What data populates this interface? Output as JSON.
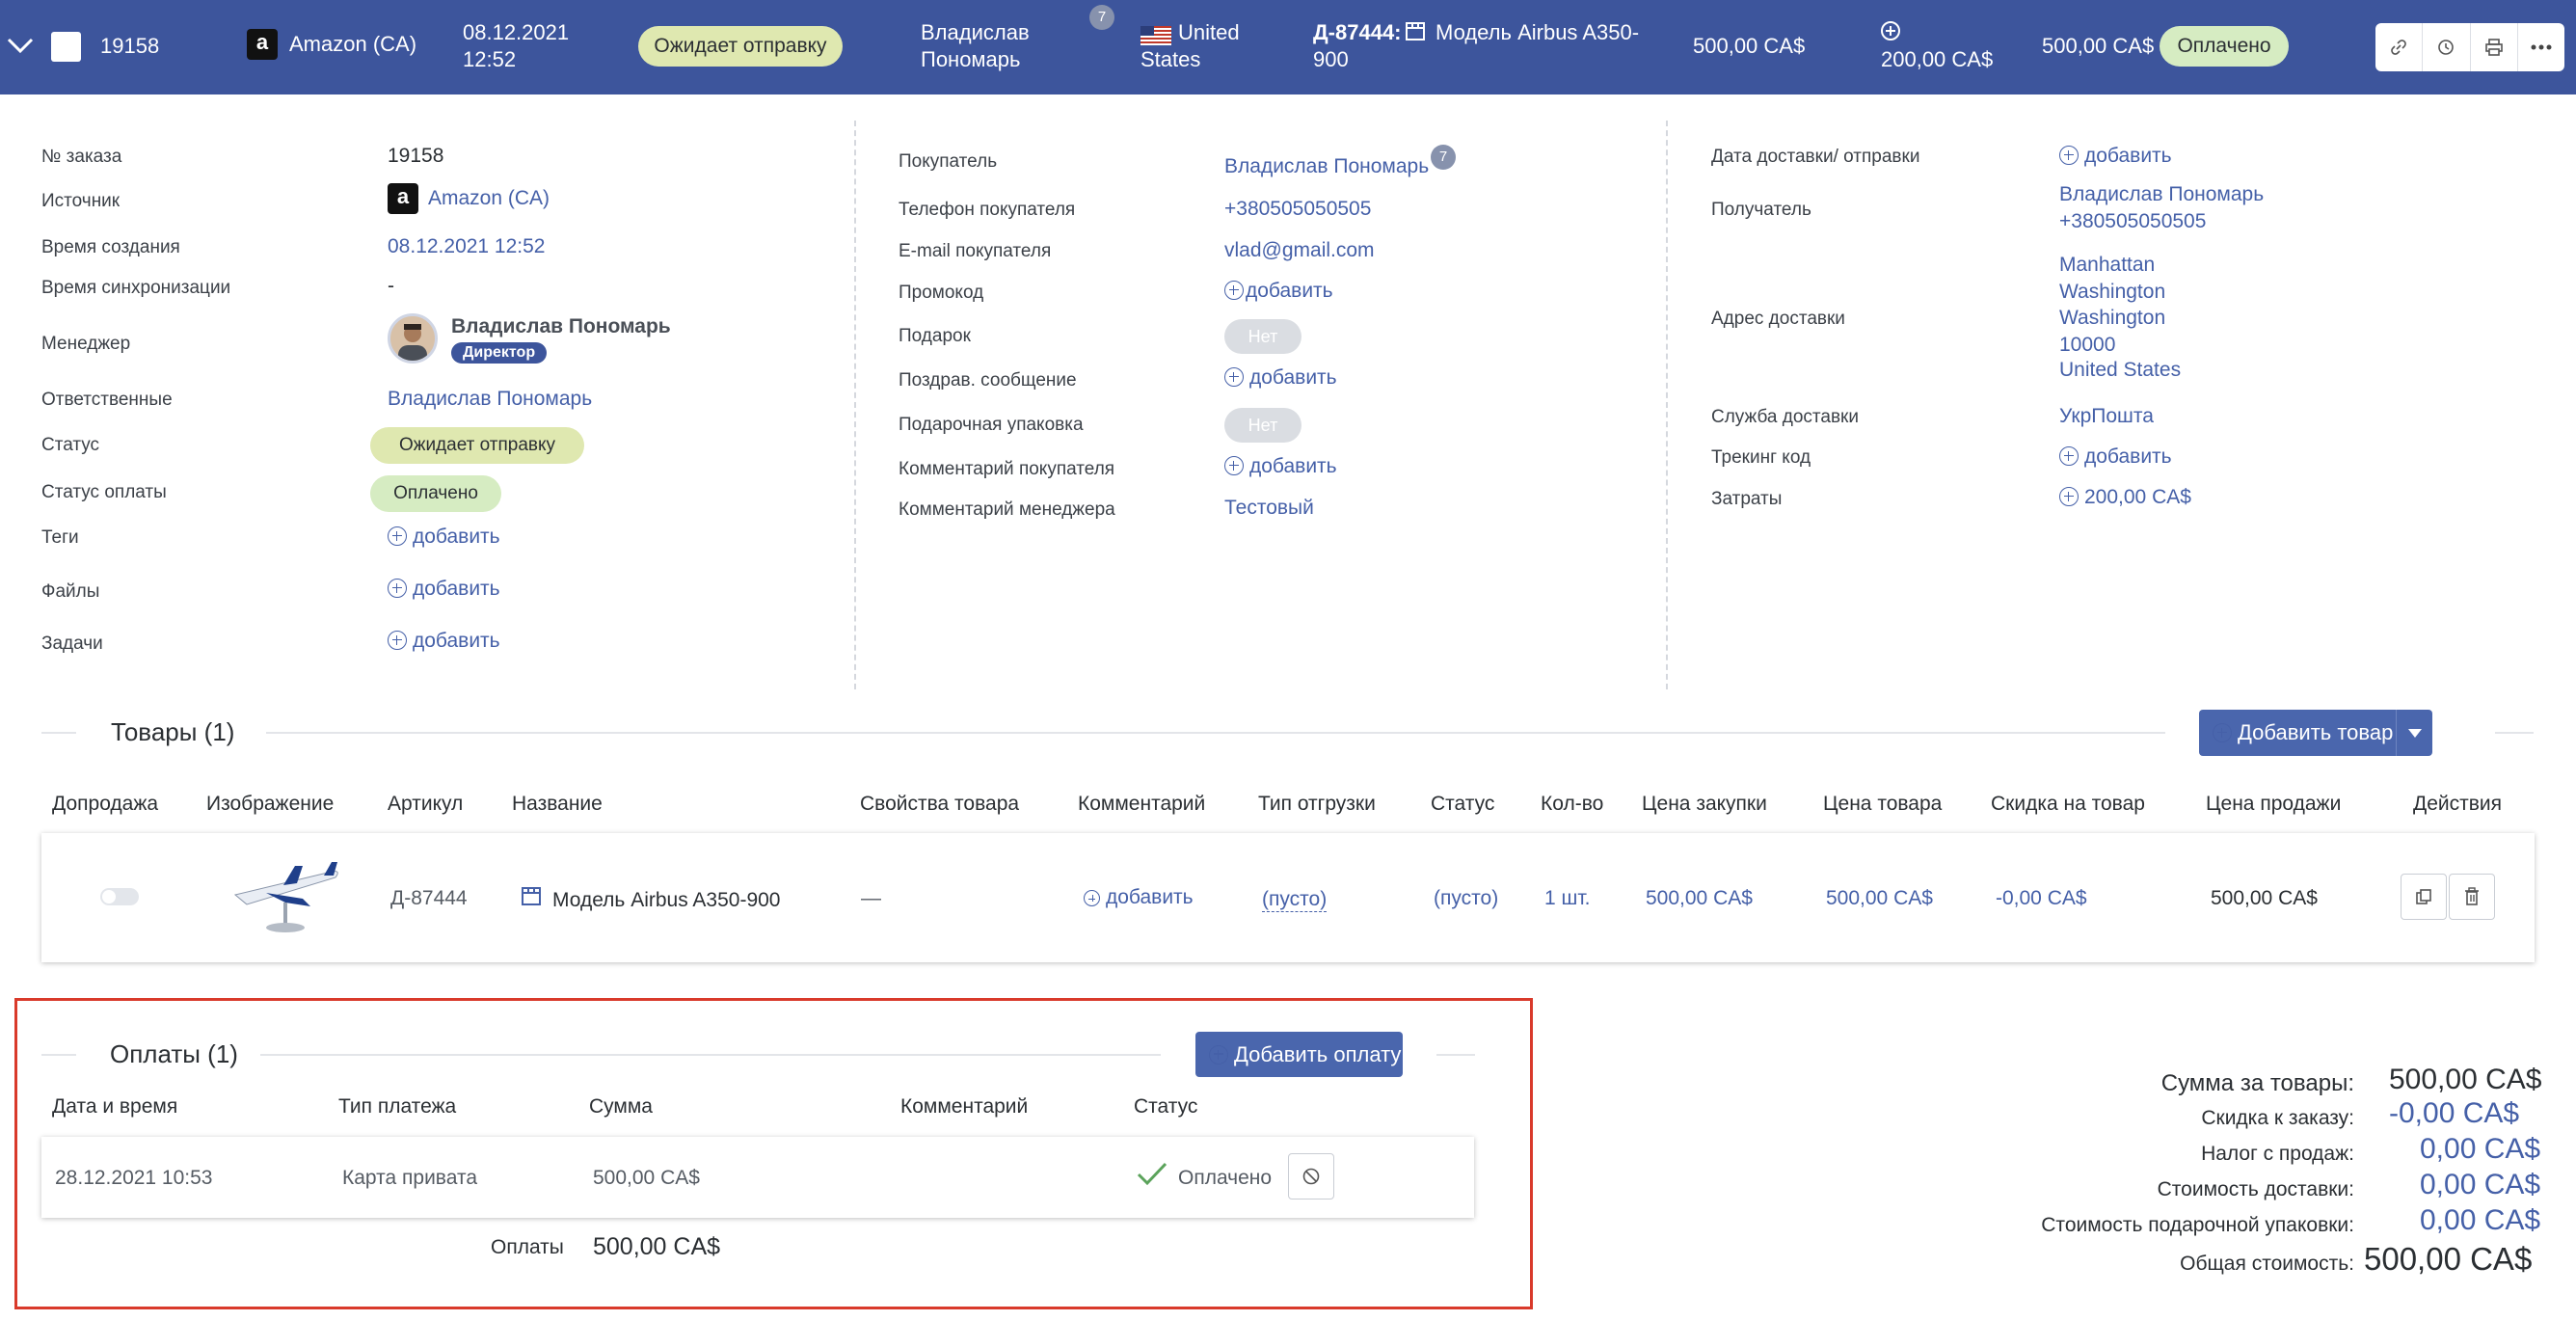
{
  "header": {
    "order_no": "19158",
    "source": "Amazon (CA)",
    "date": "08.12.2021",
    "time": "12:52",
    "status": "Ожидает отправку",
    "buyer_first": "Владислав",
    "buyer_last": "Пономарь",
    "buyer_badge": "7",
    "country_l1": "United",
    "country_l2": "States",
    "product_code": "Д-87444:",
    "product_name_l1": "Модель Airbus A350-",
    "product_name_l2": "900",
    "price": "500,00 CA$",
    "expenses": "200,00 CA$",
    "total": "500,00 CA$",
    "payment_status": "Оплачено",
    "amazon_glyph": "a"
  },
  "col1": {
    "order_no_label": "№ заказа",
    "order_no": "19158",
    "source_label": "Источник",
    "source": "Amazon (CA)",
    "created_label": "Время создания",
    "created": "08.12.2021 12:52",
    "sync_label": "Время синхронизации",
    "sync": "-",
    "manager_label": "Менеджер",
    "manager": "Владислав Пономарь",
    "manager_role": "Директор",
    "responsible_label": "Ответственные",
    "responsible": "Владислав Пономарь",
    "status_label": "Статус",
    "status": "Ожидает отправку",
    "pay_status_label": "Статус оплаты",
    "pay_status": "Оплачено",
    "tags_label": "Теги",
    "files_label": "Файлы",
    "tasks_label": "Задачи",
    "add": "добавить"
  },
  "col2": {
    "buyer_label": "Покупатель",
    "buyer": "Владислав Пономарь",
    "buyer_badge": "7",
    "phone_label": "Телефон покупателя",
    "phone": "+380505050505",
    "email_label": "E-mail покупателя",
    "email": "vlad@gmail.com",
    "promo_label": "Промокод",
    "promo": "добавить",
    "gift_label": "Подарок",
    "gift": "Нет",
    "greeting_label": "Поздрав. сообщение",
    "greeting": "добавить",
    "wrap_label": "Подарочная упаковка",
    "wrap": "Нет",
    "buyer_comment_label": "Комментарий покупателя",
    "buyer_comment": "добавить",
    "manager_comment_label": "Комментарий менеджера",
    "manager_comment": "Тестовый"
  },
  "col3": {
    "delivery_date_label": "Дата доставки/ отправки",
    "delivery_date": "добавить",
    "recipient_label": "Получатель",
    "recipient_name": "Владислав Пономарь",
    "recipient_phone": "+380505050505",
    "address_label": "Адрес доставки",
    "address": [
      "Manhattan",
      "Washington",
      "Washington",
      "10000",
      "United States"
    ],
    "service_label": "Служба доставки",
    "service": "УкрПошта",
    "tracking_label": "Трекинг код",
    "tracking": "добавить",
    "costs_label": "Затраты",
    "costs": "200,00 CA$"
  },
  "goods": {
    "title": "Товары (1)",
    "add_button": "Добавить товар",
    "columns": [
      "Допродажа",
      "Изображение",
      "Артикул",
      "Название",
      "Свойства товара",
      "Комментарий",
      "Тип отгрузки",
      "Статус",
      "Кол-во",
      "Цена закупки",
      "Цена товара",
      "Скидка на товар",
      "Цена продажи",
      "Действия"
    ],
    "row": {
      "sku": "Д-87444",
      "name": "Модель Airbus A350-900",
      "props": "—",
      "comment": "добавить",
      "ship_type": "(пусто)",
      "status": "(пусто)",
      "qty": "1 шт.",
      "purchase_price": "500,00 CA$",
      "item_price": "500,00 CA$",
      "discount": "-0,00 CA$",
      "sale_price": "500,00 CA$"
    }
  },
  "payments": {
    "title": "Оплаты (1)",
    "add_button": "Добавить оплату",
    "columns": [
      "Дата и время",
      "Тип платежа",
      "Сумма",
      "Комментарий",
      "Статус"
    ],
    "row": {
      "datetime": "28.12.2021 10:53",
      "type": "Карта привата",
      "amount": "500,00 CA$",
      "status": "Оплачено"
    },
    "footer_label": "Оплаты",
    "footer_value": "500,00 CA$"
  },
  "totals": {
    "goods_sum_label": "Сумма за товары:",
    "goods_sum": "500,00 CA$",
    "order_discount_label": "Скидка к заказу:",
    "order_discount": "-0,00 CA$",
    "sales_tax_label": "Налог с продаж:",
    "sales_tax": "0,00 CA$",
    "delivery_cost_label": "Стоимость доставки:",
    "delivery_cost": "0,00 CA$",
    "gift_wrap_cost_label": "Стоимость подарочной упаковки:",
    "gift_wrap_cost": "0,00 CA$",
    "total_label": "Общая стоимость:",
    "total": "500,00 CA$"
  },
  "colors": {
    "header_bg": "#3d559c",
    "link": "#4560a8",
    "button": "#4a66ad",
    "highlight": "#d93a2b",
    "paid_pill": "#d6ecc2",
    "wait_pill": "#dfe8b0"
  }
}
